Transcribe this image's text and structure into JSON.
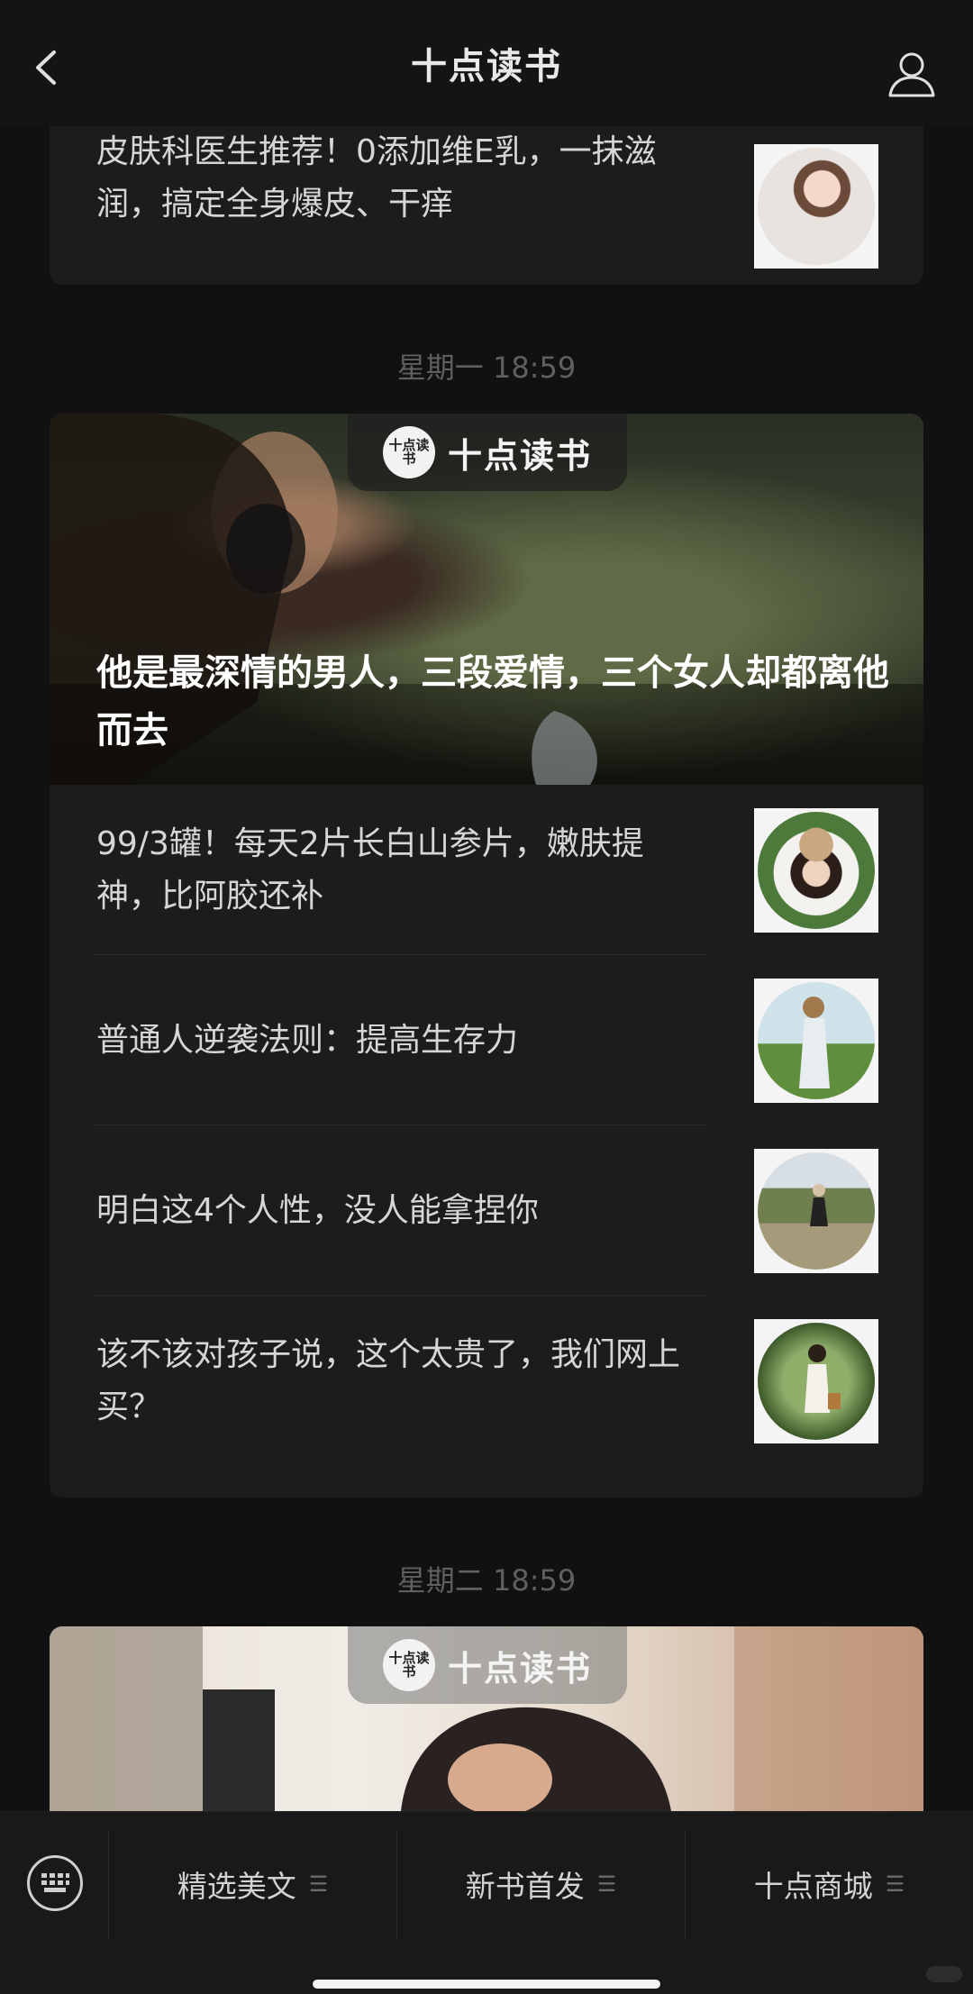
{
  "header": {
    "title": "十点读书"
  },
  "feed": {
    "top_partial_item": {
      "text": "皮肤科医生推荐！0添加维E乳，一抹滋润，搞定全身爆皮、干痒"
    },
    "timestamp_1": "星期一 18:59",
    "issue_1": {
      "brand": "十点读书",
      "logo_text": "十点读书",
      "headline": "他是最深情的男人，三段爱情，三个女人却都离他而去",
      "items": [
        {
          "text": "99/3罐！每天2片长白山参片，嫩肤提神，比阿胶还补"
        },
        {
          "text": "普通人逆袭法则：提高生存力"
        },
        {
          "text": "明白这4个人性，没人能拿捏你"
        },
        {
          "text": "该不该对孩子说，这个太贵了，我们网上买？"
        }
      ]
    },
    "timestamp_2": "星期二 18:59",
    "issue_2": {
      "brand": "十点读书",
      "logo_text": "十点读书"
    }
  },
  "bottom_menu": {
    "tabs": [
      {
        "label": "精选美文"
      },
      {
        "label": "新书首发"
      },
      {
        "label": "十点商城"
      }
    ]
  },
  "colors": {
    "background": "#111111",
    "card": "#1c1c1c",
    "text": "#d6d6d6",
    "muted": "#5f5f5f"
  }
}
